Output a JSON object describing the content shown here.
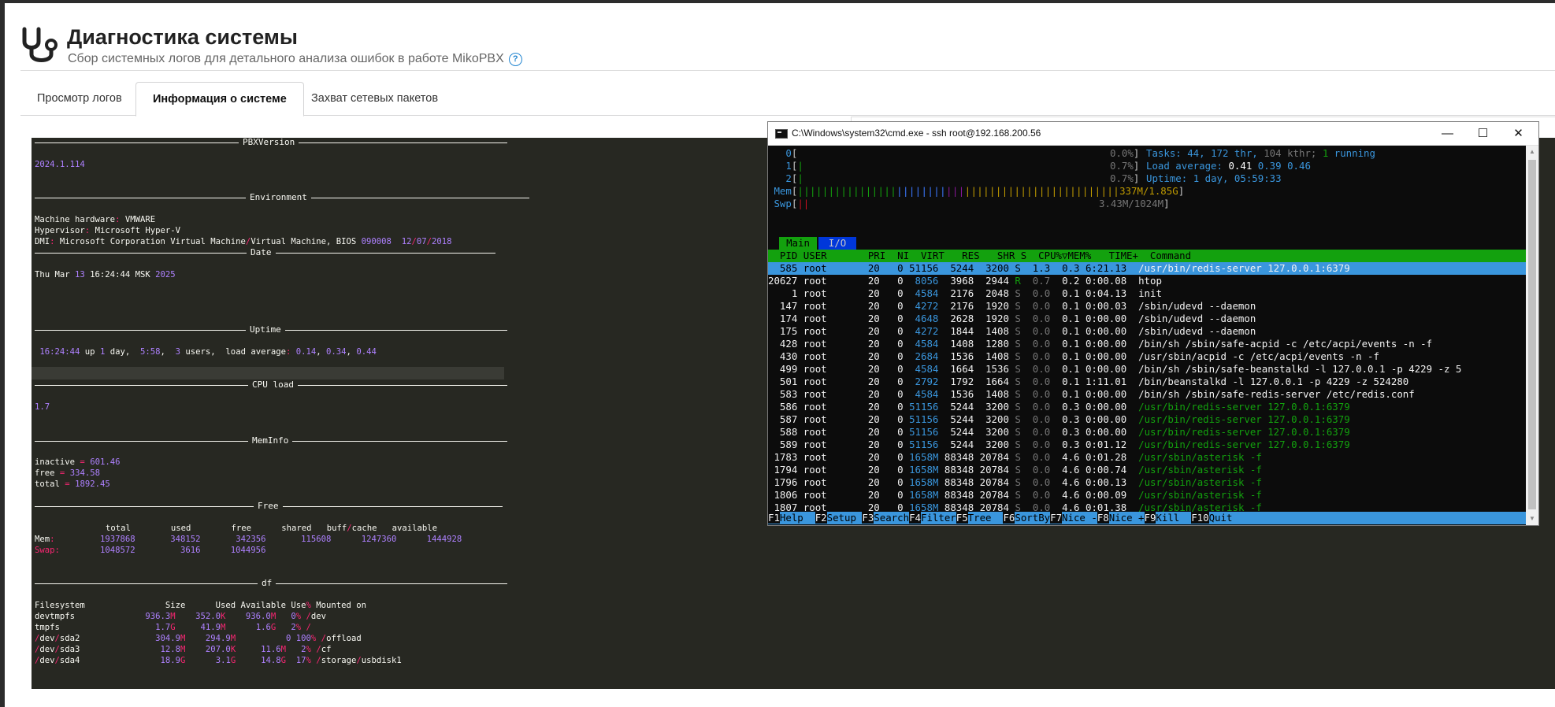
{
  "header": {
    "title": "Диагностика системы",
    "subtitle": "Сбор системных логов для детального анализа ошибок в работе MikoPBX",
    "help_icon": "question-circle-icon",
    "logo_icon": "stethoscope-icon"
  },
  "tabs": [
    {
      "label": "Просмотр логов",
      "active": false
    },
    {
      "label": "Информация о системе",
      "active": true
    },
    {
      "label": "Захват сетевых пакетов",
      "active": false
    }
  ],
  "log": {
    "sections": {
      "pbxversion": "PBXVersion",
      "environment": "Environment",
      "date": "Date",
      "uptime": "Uptime",
      "cpuload": "CPU load",
      "meminfo": "MemInfo",
      "free": "Free",
      "df": "df"
    },
    "version": "2024.1.114",
    "env": {
      "hw_label": "Machine hardware",
      "hw_value": "VMWARE",
      "hv_label": "Hypervisor",
      "hv_value": "Microsoft Hyper-V",
      "dmi_label": "DMI",
      "dmi_value": "Microsoft Corporation Virtual Machine",
      "dmi_value2": "Virtual Machine, BIOS ",
      "dmi_bios": "090008",
      "dmi_d1": "12",
      "dmi_d2": "07",
      "dmi_d3": "2018"
    },
    "date": {
      "day": "Thu Mar ",
      "d": "13",
      "time": " 16:24:44 MSK ",
      "year": "2025"
    },
    "uptime": {
      "time": "16:24:44",
      "up": " up ",
      "days": "1",
      "day_w": " day,  ",
      "hm": "5:58",
      "users_n": "3",
      "users_w": " users,  load average",
      "l1": "0.14",
      "l2": "0.34",
      "l3": "0.44"
    },
    "cpu": "1.7",
    "mem": {
      "inactive_l": "inactive",
      "inactive_v": "601.46",
      "free_l": "free",
      "free_v": "334.58",
      "total_l": "total",
      "total_v": "1892.45"
    },
    "free_table": {
      "headers": [
        "total",
        "used",
        "free",
        "shared",
        "buff",
        "cache",
        "available"
      ],
      "mem_label": "Mem",
      "mem": [
        "1937868",
        "348152",
        "342356",
        "115608",
        "1247360",
        "1444928"
      ],
      "swap_label": "Swap",
      "swap": [
        "1048572",
        "3616",
        "1044956"
      ]
    },
    "df": {
      "headers": [
        "Filesystem",
        "Size",
        "Used",
        "Available",
        "Use",
        "Mounted on"
      ],
      "rows": [
        {
          "fs": "devtmpfs",
          "size": "936.3",
          "su": "M",
          "used": "352.0",
          "uu": "K",
          "avail": "936.0",
          "au": "M",
          "use": "0",
          "mnt": "dev",
          "mnt2": ""
        },
        {
          "fs": "tmpfs",
          "size": "1.7",
          "su": "G",
          "used": "41.9",
          "uu": "M",
          "avail": "1.6",
          "au": "G",
          "use": "2",
          "mnt": "",
          "mnt2": ""
        },
        {
          "fs": "dev",
          "fs2": "sda2",
          "size": "304.9",
          "su": "M",
          "used": "294.9",
          "uu": "M",
          "avail": "0",
          "au": "",
          "use": "100",
          "mnt": "offload",
          "mnt2": ""
        },
        {
          "fs": "dev",
          "fs2": "sda3",
          "size": "12.8",
          "su": "M",
          "used": "207.0",
          "uu": "K",
          "avail": "11.6",
          "au": "M",
          "use": "2",
          "mnt": "cf",
          "mnt2": ""
        },
        {
          "fs": "dev",
          "fs2": "sda4",
          "size": "18.9",
          "su": "G",
          "used": "3.1",
          "uu": "G",
          "avail": "14.8",
          "au": "G",
          "use": "17",
          "mnt": "storage",
          "mnt2": "usbdisk1"
        }
      ]
    }
  },
  "cmd": {
    "title": "C:\\Windows\\system32\\cmd.exe - ssh  root@192.168.200.56",
    "minimize": "—",
    "maximize": "☐",
    "close": "✕",
    "cpu": [
      {
        "n": "0",
        "bar": "",
        "pct": "0.0%"
      },
      {
        "n": "1",
        "bar": "|",
        "pct": "0.7%"
      },
      {
        "n": "2",
        "bar": "|",
        "pct": "0.7%"
      }
    ],
    "mem": {
      "label": "Mem",
      "bar": "||||||||||||||||||||||||||||||||||||||||||||||||||||",
      "val": "337M/1.85G"
    },
    "swp": {
      "label": "Swp",
      "bar": "||",
      "val": "3.43M/1024M"
    },
    "tasks": {
      "label": "Tasks: ",
      "t": "44",
      "thr": "172",
      "thr_w": " thr, ",
      "kthr": "104",
      "kthr_w": " kthr; ",
      "run": "1",
      "run_w": " running"
    },
    "load": {
      "label": "Load average: ",
      "l1": "0.41",
      "l2": "0.39",
      "l3": "0.46"
    },
    "uptime": {
      "label": "Uptime: ",
      "val": "1 day, 05:59:33"
    },
    "tab_main": "Main",
    "tab_io": "I/O",
    "columns": "  PID USER       PRI  NI  VIRT   RES   SHR S  CPU%▽MEM%   TIME+  Command",
    "procs": [
      {
        "pid": "585",
        "user": "root",
        "pri": "20",
        "ni": "0",
        "virt": "51156",
        "res": "5244",
        "shr": "3200",
        "s": "S",
        "cpu": "1.3",
        "mem": "0.3",
        "time": "6:21.13",
        "cmd": "/usr/bin/redis-server 127.0.0.1:6379",
        "sel": true,
        "thr": false
      },
      {
        "pid": "20627",
        "user": "root",
        "pri": "20",
        "ni": "0",
        "virt": "8056",
        "res": "3968",
        "shr": "2944",
        "s": "R",
        "cpu": "0.7",
        "mem": "0.2",
        "time": "0:00.08",
        "cmd": "htop",
        "sel": false,
        "thr": false
      },
      {
        "pid": "1",
        "user": "root",
        "pri": "20",
        "ni": "0",
        "virt": "4584",
        "res": "2176",
        "shr": "2048",
        "s": "S",
        "cpu": "0.0",
        "mem": "0.1",
        "time": "0:04.13",
        "cmd": "init",
        "sel": false,
        "thr": false
      },
      {
        "pid": "147",
        "user": "root",
        "pri": "20",
        "ni": "0",
        "virt": "4272",
        "res": "2176",
        "shr": "1920",
        "s": "S",
        "cpu": "0.0",
        "mem": "0.1",
        "time": "0:00.03",
        "cmd": "/sbin/udevd --daemon",
        "sel": false,
        "thr": false
      },
      {
        "pid": "174",
        "user": "root",
        "pri": "20",
        "ni": "0",
        "virt": "4648",
        "res": "2628",
        "shr": "1920",
        "s": "S",
        "cpu": "0.0",
        "mem": "0.1",
        "time": "0:00.00",
        "cmd": "/sbin/udevd --daemon",
        "sel": false,
        "thr": false
      },
      {
        "pid": "175",
        "user": "root",
        "pri": "20",
        "ni": "0",
        "virt": "4272",
        "res": "1844",
        "shr": "1408",
        "s": "S",
        "cpu": "0.0",
        "mem": "0.1",
        "time": "0:00.00",
        "cmd": "/sbin/udevd --daemon",
        "sel": false,
        "thr": false
      },
      {
        "pid": "428",
        "user": "root",
        "pri": "20",
        "ni": "0",
        "virt": "4584",
        "res": "1408",
        "shr": "1280",
        "s": "S",
        "cpu": "0.0",
        "mem": "0.1",
        "time": "0:00.00",
        "cmd": "/bin/sh /sbin/safe-acpid -c /etc/acpi/events -n -f",
        "sel": false,
        "thr": false
      },
      {
        "pid": "430",
        "user": "root",
        "pri": "20",
        "ni": "0",
        "virt": "2684",
        "res": "1536",
        "shr": "1408",
        "s": "S",
        "cpu": "0.0",
        "mem": "0.1",
        "time": "0:00.00",
        "cmd": "/usr/sbin/acpid -c /etc/acpi/events -n -f",
        "sel": false,
        "thr": false
      },
      {
        "pid": "499",
        "user": "root",
        "pri": "20",
        "ni": "0",
        "virt": "4584",
        "res": "1664",
        "shr": "1536",
        "s": "S",
        "cpu": "0.0",
        "mem": "0.1",
        "time": "0:00.00",
        "cmd": "/bin/sh /sbin/safe-beanstalkd -l 127.0.0.1 -p 4229 -z 5",
        "sel": false,
        "thr": false
      },
      {
        "pid": "501",
        "user": "root",
        "pri": "20",
        "ni": "0",
        "virt": "2792",
        "res": "1792",
        "shr": "1664",
        "s": "S",
        "cpu": "0.0",
        "mem": "0.1",
        "time": "1:11.01",
        "cmd": "/bin/beanstalkd -l 127.0.0.1 -p 4229 -z 524280",
        "sel": false,
        "thr": false
      },
      {
        "pid": "583",
        "user": "root",
        "pri": "20",
        "ni": "0",
        "virt": "4584",
        "res": "1536",
        "shr": "1408",
        "s": "S",
        "cpu": "0.0",
        "mem": "0.1",
        "time": "0:00.00",
        "cmd": "/bin/sh /sbin/safe-redis-server /etc/redis.conf",
        "sel": false,
        "thr": false
      },
      {
        "pid": "586",
        "user": "root",
        "pri": "20",
        "ni": "0",
        "virt": "51156",
        "res": "5244",
        "shr": "3200",
        "s": "S",
        "cpu": "0.0",
        "mem": "0.3",
        "time": "0:00.00",
        "cmd": "/usr/bin/redis-server 127.0.0.1:6379",
        "sel": false,
        "thr": true
      },
      {
        "pid": "587",
        "user": "root",
        "pri": "20",
        "ni": "0",
        "virt": "51156",
        "res": "5244",
        "shr": "3200",
        "s": "S",
        "cpu": "0.0",
        "mem": "0.3",
        "time": "0:00.00",
        "cmd": "/usr/bin/redis-server 127.0.0.1:6379",
        "sel": false,
        "thr": true
      },
      {
        "pid": "588",
        "user": "root",
        "pri": "20",
        "ni": "0",
        "virt": "51156",
        "res": "5244",
        "shr": "3200",
        "s": "S",
        "cpu": "0.0",
        "mem": "0.3",
        "time": "0:00.00",
        "cmd": "/usr/bin/redis-server 127.0.0.1:6379",
        "sel": false,
        "thr": true
      },
      {
        "pid": "589",
        "user": "root",
        "pri": "20",
        "ni": "0",
        "virt": "51156",
        "res": "5244",
        "shr": "3200",
        "s": "S",
        "cpu": "0.0",
        "mem": "0.3",
        "time": "0:01.12",
        "cmd": "/usr/bin/redis-server 127.0.0.1:6379",
        "sel": false,
        "thr": true
      },
      {
        "pid": "1783",
        "user": "root",
        "pri": "20",
        "ni": "0",
        "virt": "1658M",
        "res": "88348",
        "shr": "20784",
        "s": "S",
        "cpu": "0.0",
        "mem": "4.6",
        "time": "0:01.28",
        "cmd": "/usr/sbin/asterisk -f",
        "sel": false,
        "thr": true
      },
      {
        "pid": "1794",
        "user": "root",
        "pri": "20",
        "ni": "0",
        "virt": "1658M",
        "res": "88348",
        "shr": "20784",
        "s": "S",
        "cpu": "0.0",
        "mem": "4.6",
        "time": "0:00.74",
        "cmd": "/usr/sbin/asterisk -f",
        "sel": false,
        "thr": true
      },
      {
        "pid": "1796",
        "user": "root",
        "pri": "20",
        "ni": "0",
        "virt": "1658M",
        "res": "88348",
        "shr": "20784",
        "s": "S",
        "cpu": "0.0",
        "mem": "4.6",
        "time": "0:00.13",
        "cmd": "/usr/sbin/asterisk -f",
        "sel": false,
        "thr": true
      },
      {
        "pid": "1806",
        "user": "root",
        "pri": "20",
        "ni": "0",
        "virt": "1658M",
        "res": "88348",
        "shr": "20784",
        "s": "S",
        "cpu": "0.0",
        "mem": "4.6",
        "time": "0:00.09",
        "cmd": "/usr/sbin/asterisk -f",
        "sel": false,
        "thr": true
      },
      {
        "pid": "1807",
        "user": "root",
        "pri": "20",
        "ni": "0",
        "virt": "1658M",
        "res": "88348",
        "shr": "20784",
        "s": "S",
        "cpu": "0.0",
        "mem": "4.6",
        "time": "0:01.38",
        "cmd": "/usr/sbin/asterisk -f",
        "sel": false,
        "thr": true
      }
    ],
    "fkeys": [
      {
        "k": "F1",
        "l": "Help  "
      },
      {
        "k": "F2",
        "l": "Setup "
      },
      {
        "k": "F3",
        "l": "Search"
      },
      {
        "k": "F4",
        "l": "Filter"
      },
      {
        "k": "F5",
        "l": "Tree  "
      },
      {
        "k": "F6",
        "l": "SortBy"
      },
      {
        "k": "F7",
        "l": "Nice -"
      },
      {
        "k": "F8",
        "l": "Nice +"
      },
      {
        "k": "F9",
        "l": "Kill  "
      },
      {
        "k": "F10",
        "l": "Quit  "
      }
    ]
  },
  "colors": {
    "accent": "#2185d0",
    "terminal_bg": "#272822",
    "purple": "#ae81ff",
    "red": "#f92672"
  }
}
